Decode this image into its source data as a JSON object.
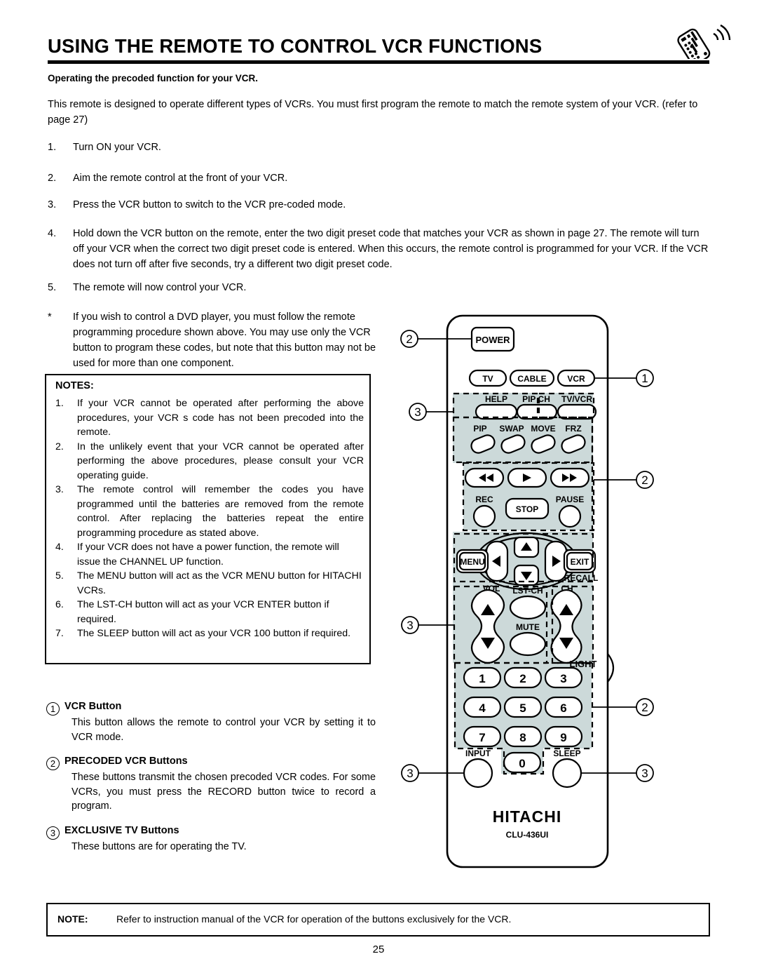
{
  "header": {
    "title": "USING THE REMOTE TO CONTROL VCR FUNCTIONS",
    "icon": "remote-control-signal-icon",
    "subtitle": "Operating the precoded function for your VCR."
  },
  "intro": "This remote is designed to operate different types of VCRs.  You must first program the remote to match the remote system of your VCR. (refer to page 27)",
  "steps": [
    {
      "num": "1.",
      "text": "Turn ON your VCR."
    },
    {
      "num": "2.",
      "text": "Aim the remote control at the front of your VCR."
    },
    {
      "num": "3.",
      "text": "Press the VCR button to switch to the VCR pre-coded mode."
    },
    {
      "num": "4.",
      "text": "Hold down the VCR button on the remote, enter the two digit preset code that matches your VCR as shown in page 27.  The remote will turn off your VCR when the correct two digit preset code is entered.  When this occurs, the remote control is programmed for your VCR.  If the VCR does not turn off after five seconds, try a different two digit preset code."
    },
    {
      "num": "5.",
      "text": "The remote will now control your VCR."
    },
    {
      "num": "*",
      "text": "If you wish to control a DVD player, you must follow the remote programming procedure shown above.  You may use only the VCR button to program these codes, but note that this button may not be used for more than one component."
    }
  ],
  "notes": {
    "heading": "NOTES:",
    "items": [
      {
        "num": "1.",
        "text": "If your VCR cannot be operated after performing the above procedures, your VCR s code has not been precoded into the remote."
      },
      {
        "num": "2.",
        "text": "In the unlikely event that your VCR cannot be operated after performing the above procedures, please consult your VCR operating guide."
      },
      {
        "num": "3.",
        "text": "The remote control will remember the codes you have programmed until the batteries are removed from the remote control.  After replacing the batteries repeat the entire programming procedure as stated above."
      },
      {
        "num": "4.",
        "text": "If your VCR does not have a power function, the remote will issue the CHANNEL UP function."
      },
      {
        "num": "5.",
        "text": "The MENU button will act as the VCR MENU button for HITACHI VCRs."
      },
      {
        "num": "6.",
        "text": "The LST-CH button will act as your VCR ENTER button if required."
      },
      {
        "num": "7.",
        "text": "The SLEEP button will act as your VCR  100  button if required."
      }
    ]
  },
  "legend": [
    {
      "marker": "1",
      "title": "VCR Button",
      "body": "This button allows the remote to control your VCR by  setting it to VCR mode."
    },
    {
      "marker": "2",
      "title": "PRECODED VCR Buttons",
      "body": "These buttons transmit the chosen precoded VCR codes. For some VCRs, you must press the RECORD button twice to record a program."
    },
    {
      "marker": "3",
      "title": "EXCLUSIVE TV Buttons",
      "body": "These buttons are for operating the TV."
    }
  ],
  "bottom_note": {
    "label": "NOTE:",
    "text": "Refer to instruction manual of the VCR for operation of the buttons exclusively for the VCR."
  },
  "page_number": "25",
  "remote": {
    "brand": "HITACHI",
    "model": "CLU-436UI",
    "light_label": "LIGHT",
    "buttons": {
      "power": "POWER",
      "tv": "TV",
      "cable": "CABLE",
      "vcr": "VCR",
      "help": "HELP",
      "pip_ch": "PIP CH",
      "tv_vcr": "TV/VCR",
      "pip": "PIP",
      "swap": "SWAP",
      "move": "MOVE",
      "frz": "FRZ",
      "rew": "◀◀",
      "play": "▶",
      "ff": "▶▶",
      "rec": "REC",
      "stop": "STOP",
      "pause": "PAUSE",
      "menu": "MENU",
      "exit": "EXIT",
      "recall": "RECALL",
      "vol": "VOL",
      "lst_ch": "LST-CH",
      "mute": "MUTE",
      "ch": "CH",
      "input": "INPUT",
      "sleep": "SLEEP",
      "keys": [
        "1",
        "2",
        "3",
        "4",
        "5",
        "6",
        "7",
        "8",
        "9",
        "0"
      ]
    },
    "callouts": [
      {
        "marker": "2",
        "target": "power-button"
      },
      {
        "marker": "1",
        "target": "vcr-button"
      },
      {
        "marker": "3",
        "target": "exclusive-tv-group-top"
      },
      {
        "marker": "2",
        "target": "precoded-transport-group"
      },
      {
        "marker": "3",
        "target": "exclusive-tv-group-vol"
      },
      {
        "marker": "2",
        "target": "precoded-keypad-group"
      },
      {
        "marker": "3",
        "target": "input-button"
      },
      {
        "marker": "3",
        "target": "sleep-button"
      }
    ]
  },
  "colors": {
    "shade": "#ccd9d9",
    "ink": "#000000",
    "paper": "#ffffff"
  }
}
